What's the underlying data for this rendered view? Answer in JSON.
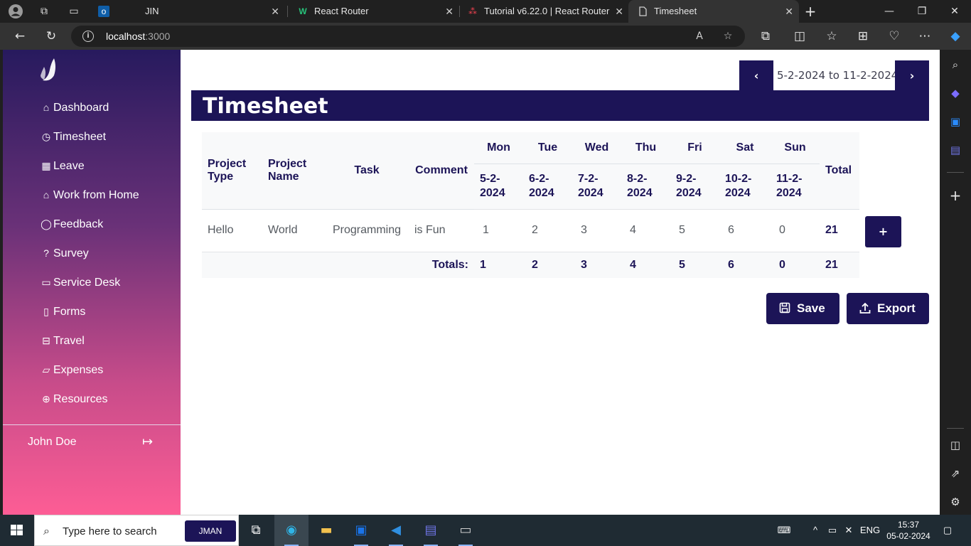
{
  "browser": {
    "tabs": [
      {
        "label": "JIN",
        "icon": "outlook-icon"
      },
      {
        "label": "React Router",
        "icon": "w-logo-icon"
      },
      {
        "label": "Tutorial v6.22.0 | React Router",
        "icon": "react-router-icon"
      },
      {
        "label": "Timesheet",
        "icon": "page-icon"
      }
    ],
    "url_host": "localhost",
    "url_port": ":3000"
  },
  "sidebar": {
    "items": [
      {
        "label": "Dashboard",
        "icon": "home-icon"
      },
      {
        "label": "Timesheet",
        "icon": "clock-icon"
      },
      {
        "label": "Leave",
        "icon": "calendar-icon"
      },
      {
        "label": "Work from Home",
        "icon": "home-icon"
      },
      {
        "label": "Feedback",
        "icon": "chat-icon"
      },
      {
        "label": "Survey",
        "icon": "question-icon"
      },
      {
        "label": "Service Desk",
        "icon": "monitor-icon"
      },
      {
        "label": "Forms",
        "icon": "file-icon"
      },
      {
        "label": "Travel",
        "icon": "car-icon"
      },
      {
        "label": "Expenses",
        "icon": "wallet-icon"
      },
      {
        "label": "Resources",
        "icon": "globe-icon"
      }
    ],
    "user_name": "John Doe"
  },
  "timesheet": {
    "week_range": "5-2-2024 to 11-2-2024",
    "title": "Timesheet",
    "headers": {
      "project_type": "Project Type",
      "project_name": "Project Name",
      "task": "Task",
      "comment": "Comment",
      "total": "Total"
    },
    "days": [
      {
        "day": "Mon",
        "date": "5-2-2024"
      },
      {
        "day": "Tue",
        "date": "6-2-2024"
      },
      {
        "day": "Wed",
        "date": "7-2-2024"
      },
      {
        "day": "Thu",
        "date": "8-2-2024"
      },
      {
        "day": "Fri",
        "date": "9-2-2024"
      },
      {
        "day": "Sat",
        "date": "10-2-2024"
      },
      {
        "day": "Sun",
        "date": "11-2-2024"
      }
    ],
    "rows": [
      {
        "project_type": "Hello",
        "project_name": "World",
        "task": "Programming",
        "comment": "is Fun",
        "hours": [
          "1",
          "2",
          "3",
          "4",
          "5",
          "6",
          "0"
        ],
        "total": "21"
      }
    ],
    "totals_label": "Totals:",
    "totals": [
      "1",
      "2",
      "3",
      "4",
      "5",
      "6",
      "0"
    ],
    "grand_total": "21",
    "add_label": "+",
    "save_label": "Save",
    "export_label": "Export"
  },
  "taskbar": {
    "search_placeholder": "Type here to search",
    "search_badge": "JMAN",
    "language": "ENG",
    "time": "15:37",
    "date": "05-02-2024"
  },
  "colors": {
    "brand_navy": "#1c1457",
    "sidebar_top": "#271a5e",
    "sidebar_bottom": "#fd5d95"
  }
}
